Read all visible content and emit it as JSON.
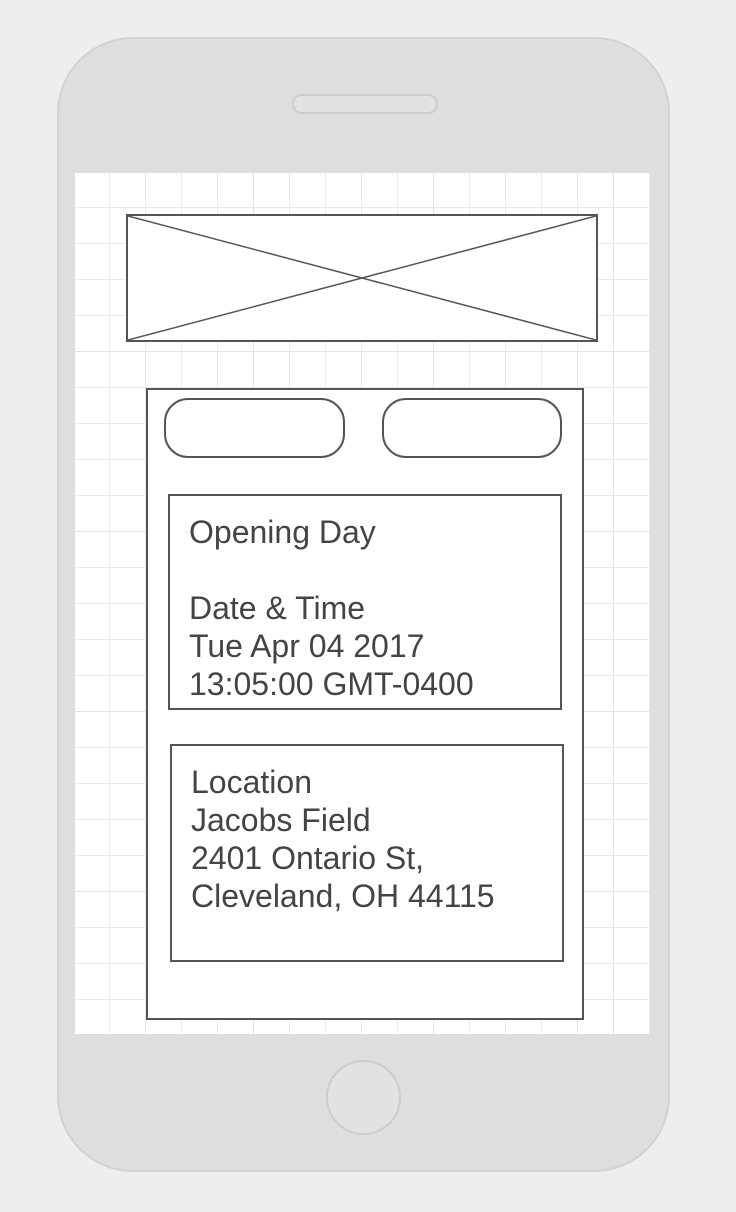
{
  "event": {
    "title": "Opening Day",
    "datetime_label": "Date & Time",
    "date": "Tue Apr 04 2017",
    "time": "13:05:00 GMT-0400"
  },
  "location": {
    "label": "Location",
    "venue": "Jacobs Field",
    "street": "2401 Ontario St,",
    "city": "Cleveland, OH 44115"
  },
  "colors": {
    "outline": "#555555",
    "text": "#444444",
    "device": "#dedede",
    "background": "#eeeeee"
  },
  "icons": {
    "banner": "image-placeholder-icon"
  }
}
